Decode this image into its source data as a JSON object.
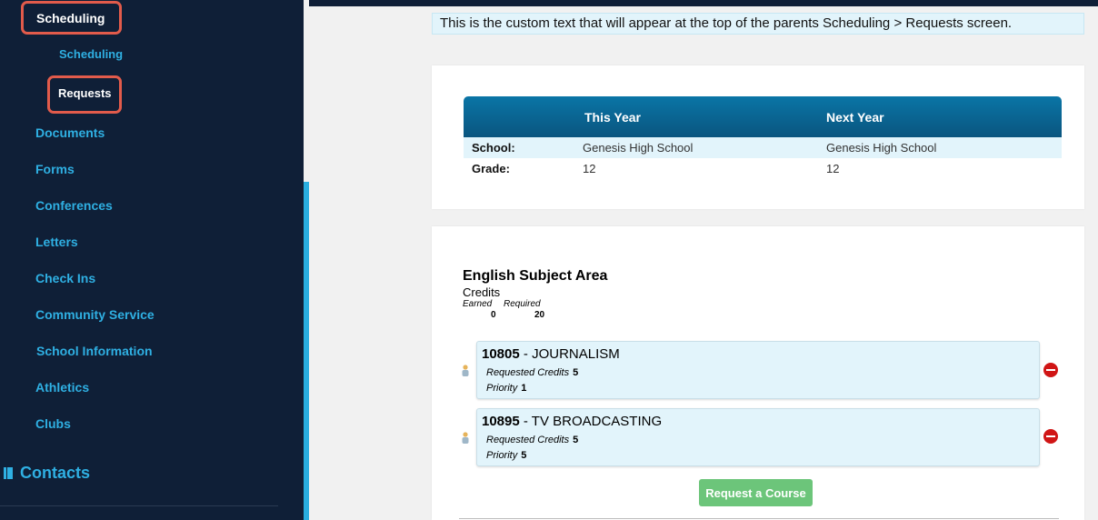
{
  "sidebar": {
    "items": [
      {
        "label": "Scheduling"
      },
      {
        "label": "Scheduling"
      },
      {
        "label": "Requests"
      },
      {
        "label": "Documents"
      },
      {
        "label": "Forms"
      },
      {
        "label": "Conferences"
      },
      {
        "label": "Letters"
      },
      {
        "label": "Check Ins"
      },
      {
        "label": "Community Service"
      },
      {
        "label": "School Information"
      },
      {
        "label": "Athletics"
      },
      {
        "label": "Clubs"
      }
    ],
    "contacts_label": "Contacts"
  },
  "main": {
    "custom_text": "This is the custom text that will appear at the top of the parents Scheduling > Requests screen.",
    "info": {
      "header": {
        "this_year": "This Year",
        "next_year": "Next Year"
      },
      "rows": [
        {
          "label": "School:",
          "this_year": "Genesis High School",
          "next_year": "Genesis High School"
        },
        {
          "label": "Grade:",
          "this_year": "12",
          "next_year": "12"
        }
      ]
    },
    "subject": {
      "title": "English Subject Area",
      "credits_label": "Credits",
      "earned_label": "Earned",
      "required_label": "Required",
      "earned": "0",
      "required": "20"
    },
    "courses": [
      {
        "code": "10805",
        "name": "JOURNALISM",
        "requested_credits_label": "Requested Credits",
        "requested_credits": "5",
        "priority_label": "Priority",
        "priority": "1"
      },
      {
        "code": "10895",
        "name": "TV BROADCASTING",
        "requested_credits_label": "Requested Credits",
        "requested_credits": "5",
        "priority_label": "Priority",
        "priority": "5"
      }
    ],
    "request_button": "Request a Course"
  },
  "colors": {
    "sidebar_bg": "#0f1f37",
    "nav_text": "#2fb0e3",
    "highlight": "#e25b4b",
    "header_blue": "#0a6594",
    "row_tint": "#e2f4fb",
    "button_green": "#6cc57a",
    "remove_red": "#d01515"
  },
  "icons": [
    "book-icon",
    "person-icon",
    "remove-icon"
  ]
}
